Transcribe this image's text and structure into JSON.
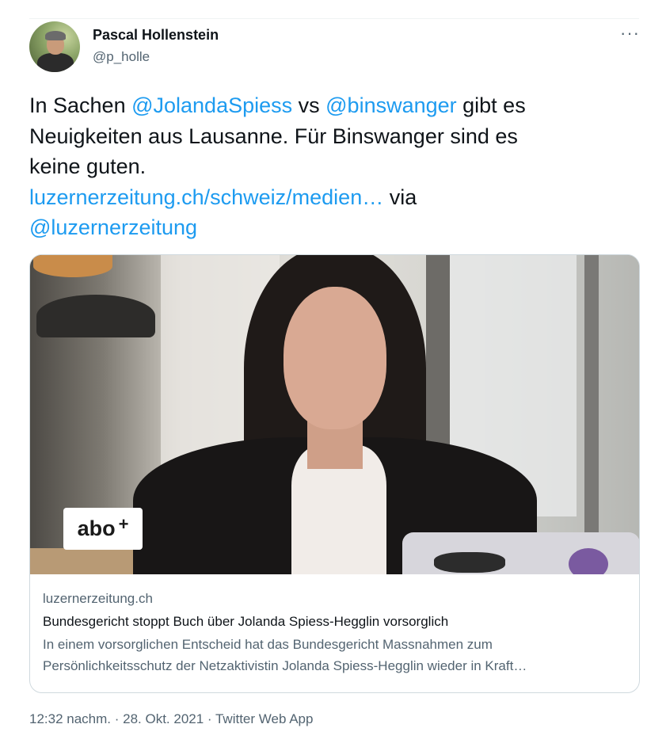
{
  "author": {
    "name": "Pascal Hollenstein",
    "handle": "@p_holle",
    "more_icon": "more-horizontal-icon"
  },
  "tweet": {
    "line1_prefix": "In Sachen ",
    "mention1": "@JolandaSpiess",
    "line1_mid": " vs ",
    "mention2": "@binswanger",
    "line1_suffix": " gibt es",
    "line2": "Neuigkeiten aus Lausanne. Für Binswanger sind es",
    "line3": "keine guten.",
    "url": "luzernerzeitung.ch/schweiz/medien…",
    "via": " via",
    "mention3": "@luzernerzeitung"
  },
  "card": {
    "badge_text": "abo",
    "badge_plus": "+",
    "domain": "luzernerzeitung.ch",
    "title": "Bundesgericht stoppt Buch über Jolanda Spiess-Hegglin vorsorglich",
    "description_line1": "In einem vorsorglichen Entscheid hat das Bundesgericht Massnahmen zum",
    "description_line2": "Persönlichkeitsschutz der Netzaktivistin Jolanda Spiess-Hegglin wieder in Kraft…"
  },
  "footer": {
    "timestamp": "12:32 nachm. · 28. Okt. 2021 · Twitter Web App"
  },
  "colors": {
    "link": "#1d9bf0",
    "text": "#0f1419",
    "secondary": "#536471",
    "border": "#cfd9de"
  }
}
